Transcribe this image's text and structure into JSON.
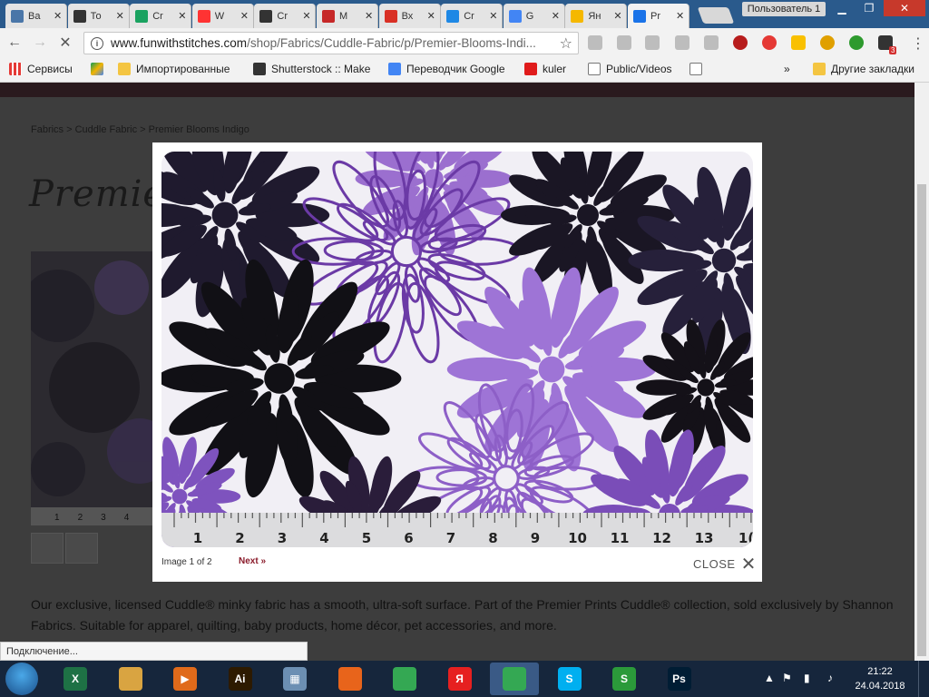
{
  "browser": {
    "tabs": [
      {
        "label": "Ва",
        "icon": "vk-icon",
        "color": "#4a76a8"
      },
      {
        "label": "То",
        "icon": "dark-square-icon",
        "color": "#333333"
      },
      {
        "label": "Cr",
        "icon": "green-circle-icon",
        "color": "#1aa260"
      },
      {
        "label": "W",
        "icon": "yandex-icon",
        "color": "#ff3333"
      },
      {
        "label": "Cr",
        "icon": "dark-square-icon",
        "color": "#333333"
      },
      {
        "label": "M",
        "icon": "red-square-icon",
        "color": "#c62828"
      },
      {
        "label": "Вх",
        "icon": "gmail-icon",
        "color": "#d93025"
      },
      {
        "label": "Cr",
        "icon": "k-icon",
        "color": "#1e88e5"
      },
      {
        "label": "G",
        "icon": "google-translate-icon",
        "color": "#4285f4"
      },
      {
        "label": "Ян",
        "icon": "yellow-icon",
        "color": "#f5b800"
      },
      {
        "label": "Pr",
        "icon": "loading-dot-icon",
        "color": "#1a73e8"
      }
    ],
    "user_button": "Пользователь 1",
    "url_host": "www.funwithstitches.com",
    "url_path": "/shop/Fabrics/Cuddle-Fabric/p/Premier-Blooms-Indi...",
    "bookmarks": [
      {
        "label": "Сервисы",
        "icon": "apps-grid-icon"
      },
      {
        "label": "",
        "icon": "google-drive-icon"
      },
      {
        "label": "Импортированные",
        "icon": "folder-icon"
      },
      {
        "label": "Shutterstock :: Make",
        "icon": "shutterstock-icon"
      },
      {
        "label": "Переводчик Google",
        "icon": "google-translate-icon"
      },
      {
        "label": "kuler",
        "icon": "adobe-icon"
      },
      {
        "label": "Public/Videos",
        "icon": "page-icon"
      },
      {
        "label": "",
        "icon": "page-icon"
      }
    ],
    "bookmarks_more": "»",
    "other_bookmarks": "Другие закладки",
    "extension_badge": "3",
    "status_text": "Подключение..."
  },
  "page": {
    "breadcrumb": "Fabrics > Cuddle Fabric > Premier Blooms Indigo",
    "title_partial": "Premie",
    "description": "Our exclusive, licensed Cuddle® minky fabric has a smooth, ultra-soft surface. Part of the Premier Prints Cuddle® collection, sold exclusively by Shannon Fabrics. Suitable for apparel, quilting, baby products, home décor, pet accessories, and more.",
    "thumb_ruler": [
      "1",
      "2",
      "3",
      "4"
    ]
  },
  "lightbox": {
    "counter": "Image 1 of 2",
    "next": "Next »",
    "close": "CLOSE",
    "ruler_numbers": [
      "1",
      "2",
      "3",
      "4",
      "5",
      "6",
      "7",
      "8",
      "9",
      "10",
      "11",
      "12",
      "13",
      "1("
    ]
  },
  "taskbar": {
    "time": "21:22",
    "date": "24.04.2018",
    "apps": [
      {
        "name": "excel",
        "icon": "excel-icon",
        "color": "#1e7145",
        "text": "X"
      },
      {
        "name": "explorer",
        "icon": "folder-icon",
        "color": "#d9a441",
        "text": ""
      },
      {
        "name": "media",
        "icon": "media-player-icon",
        "color": "#e06a1a",
        "text": "▶"
      },
      {
        "name": "illustrator",
        "icon": "illustrator-icon",
        "color": "#2d1a00",
        "text": "Ai"
      },
      {
        "name": "calculator",
        "icon": "calculator-icon",
        "color": "#6c8fb3",
        "text": "▦"
      },
      {
        "name": "firefox",
        "icon": "firefox-icon",
        "color": "#e8641b",
        "text": ""
      },
      {
        "name": "chrome",
        "icon": "chrome-icon",
        "color": "#34a853",
        "text": ""
      },
      {
        "name": "yandex",
        "icon": "yandex-icon",
        "color": "#e62020",
        "text": "Я"
      },
      {
        "name": "chrome2",
        "icon": "chrome-icon",
        "color": "#34a853",
        "text": ""
      },
      {
        "name": "skype",
        "icon": "skype-icon",
        "color": "#00aff0",
        "text": "S"
      },
      {
        "name": "app",
        "icon": "s-logo-icon",
        "color": "#2b9a3a",
        "text": "S"
      },
      {
        "name": "photoshop",
        "icon": "photoshop-icon",
        "color": "#001d34",
        "text": "Ps"
      }
    ]
  }
}
